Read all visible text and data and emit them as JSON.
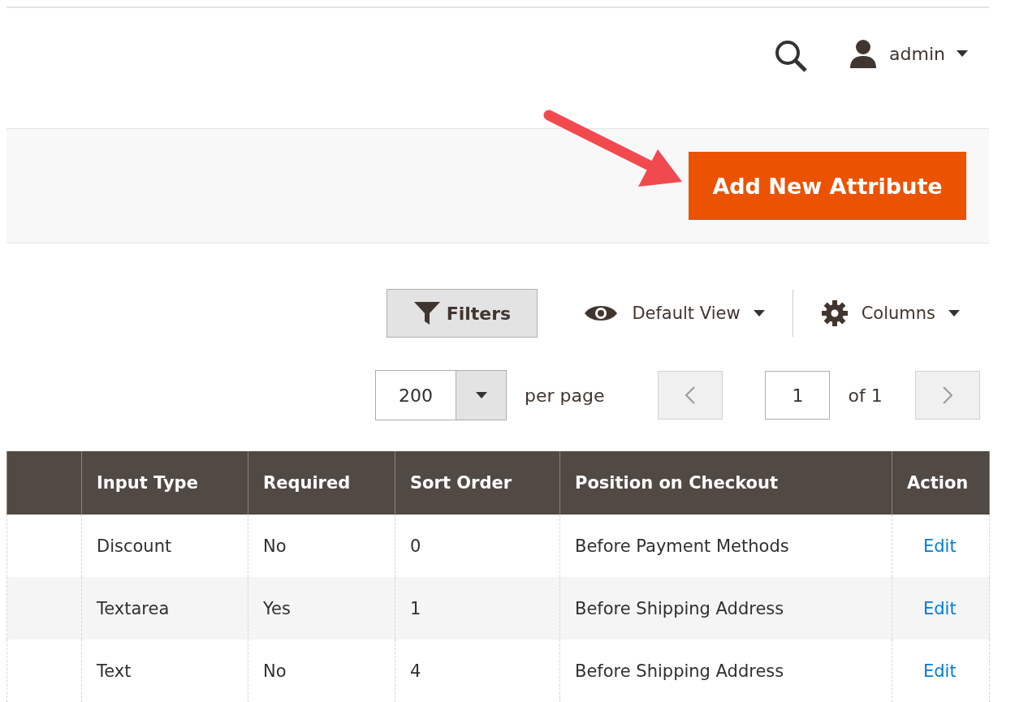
{
  "header": {
    "user": "admin"
  },
  "action_bar": {
    "primary_button": "Add New Attribute"
  },
  "toolbar": {
    "filters": "Filters",
    "view": "Default View",
    "columns": "Columns"
  },
  "pagination": {
    "per_page_value": "200",
    "per_page_label": "per page",
    "page": "1",
    "page_count": "of 1"
  },
  "table": {
    "columns": [
      "Input Type",
      "Required",
      "Sort Order",
      "Position on Checkout",
      "Action"
    ],
    "rows": [
      {
        "input_type": "Discount",
        "required": "No",
        "sort_order": "0",
        "position": "Before Payment Methods",
        "action": "Edit"
      },
      {
        "input_type": "Textarea",
        "required": "Yes",
        "sort_order": "1",
        "position": "Before Shipping Address",
        "action": "Edit"
      },
      {
        "input_type": "Text",
        "required": "No",
        "sort_order": "4",
        "position": "Before Shipping Address",
        "action": "Edit"
      }
    ]
  }
}
